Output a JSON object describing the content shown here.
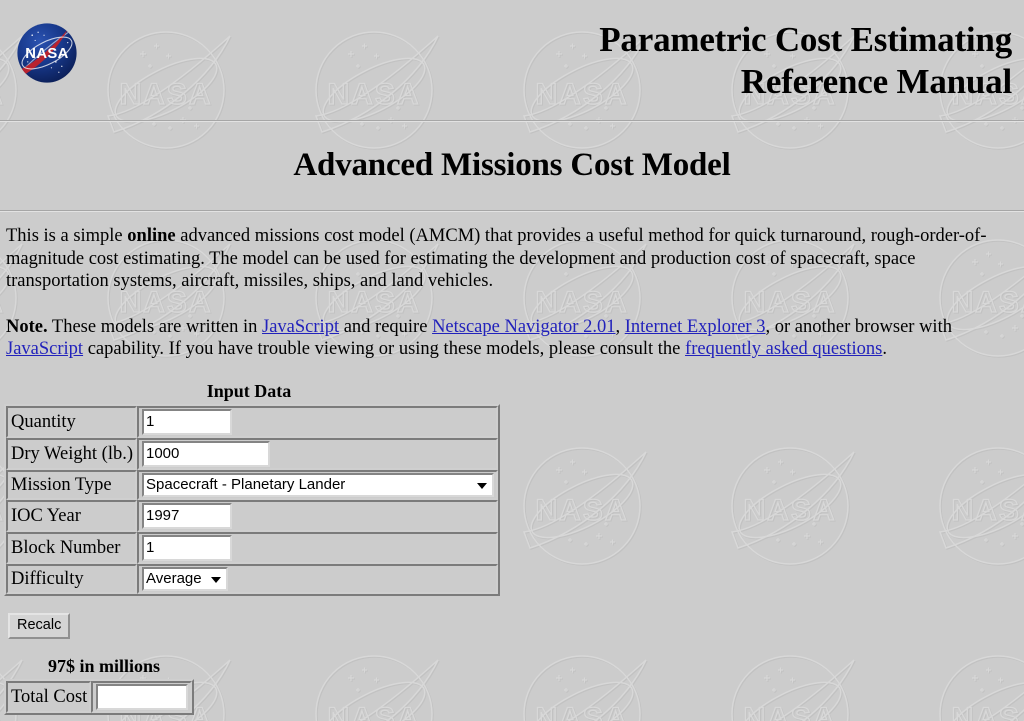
{
  "page": {
    "background_color": "#cccccc",
    "link_color": "#2222bb",
    "watermark_alt": "nasa-meatball-watermark"
  },
  "masthead": {
    "logo_alt": "nasa-meatball-logo",
    "title": "Parametric Cost Estimating\nReference Manual"
  },
  "heading": {
    "text": "Advanced Missions Cost Model"
  },
  "intro": {
    "part1": "This is a simple ",
    "bold": "online",
    "part2": " advanced missions cost model (AMCM) that provides a useful method for quick turnaround, rough-order-of-magnitude cost estimating. The model can be used for estimating the development and production cost of spacecraft, space transportation systems, aircraft, missiles, ships, and land vehicles."
  },
  "note": {
    "label": "Note.",
    "t1": " These models are written in ",
    "link1": "JavaScript",
    "t2": " and require ",
    "link2": "Netscape Navigator 2.01",
    "t3": ", ",
    "link3": "Internet Explorer 3",
    "t4": ", or another browser with ",
    "link4": "JavaScript",
    "t5": " capability. If you have trouble viewing or using these models, please consult the ",
    "link5": "frequently asked questions",
    "t6": "."
  },
  "input_table": {
    "caption": "Input Data",
    "rows": [
      {
        "label": "Quantity",
        "type": "text",
        "value": "1"
      },
      {
        "label": "Dry Weight (lb.)",
        "type": "text",
        "value": "1000"
      },
      {
        "label": "Mission Type",
        "type": "select",
        "value": "Spacecraft - Planetary Lander"
      },
      {
        "label": "IOC Year",
        "type": "text",
        "value": "1997"
      },
      {
        "label": "Block Number",
        "type": "text",
        "value": "1"
      },
      {
        "label": "Difficulty",
        "type": "select",
        "value": "Average"
      }
    ]
  },
  "mission_type_options": [
    "Spacecraft - Planetary Lander"
  ],
  "difficulty_options": [
    "Average"
  ],
  "recalc_button": {
    "label": "Recalc"
  },
  "output": {
    "caption": "97$ in millions",
    "label": "Total Cost",
    "value": ""
  }
}
